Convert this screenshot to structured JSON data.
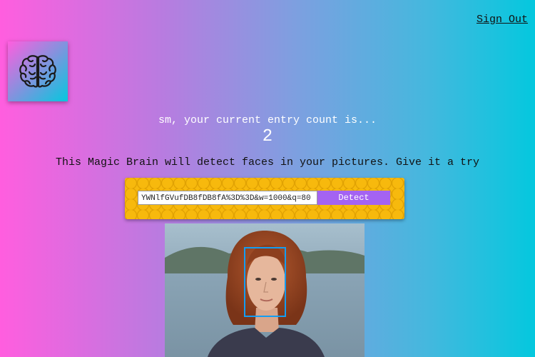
{
  "nav": {
    "sign_out_label": "Sign Out"
  },
  "logo": {
    "icon": "brain-icon",
    "gradient_start": "#ff5edf",
    "gradient_end": "#04c8de"
  },
  "rank": {
    "message": "sm, your current entry count is...",
    "count": "2"
  },
  "intro": {
    "text": "This Magic Brain will detect faces in your pictures. Give it a try"
  },
  "form": {
    "url_value": "YWNlfGVufDB8fDB8fA%3D%3D&w=1000&q=80",
    "detect_label": "Detect",
    "button_color": "#a463f2",
    "panel_color": "#f7b90d"
  },
  "result": {
    "image_icon": "portrait-photo",
    "face_box_color": "#149df2"
  }
}
